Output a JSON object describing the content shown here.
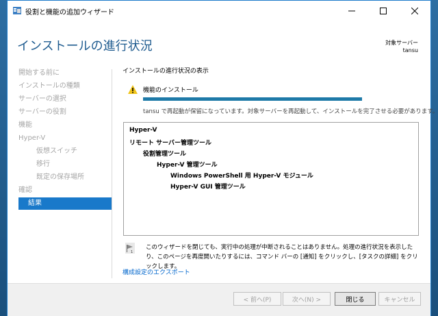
{
  "window": {
    "title": "役割と機能の追加ウィザード",
    "min_icon": "minimize-icon",
    "max_icon": "maximize-icon",
    "close_icon": "close-icon"
  },
  "header": {
    "title": "インストールの進行状況",
    "target_label": "対象サーバー",
    "target_name": "tansu"
  },
  "sidebar": {
    "items": [
      {
        "label": "開始する前に",
        "indent": false,
        "active": false
      },
      {
        "label": "インストールの種類",
        "indent": false,
        "active": false
      },
      {
        "label": "サーバーの選択",
        "indent": false,
        "active": false
      },
      {
        "label": "サーバーの役割",
        "indent": false,
        "active": false
      },
      {
        "label": "機能",
        "indent": false,
        "active": false
      },
      {
        "label": "Hyper-V",
        "indent": false,
        "active": false
      },
      {
        "label": "仮想スイッチ",
        "indent": true,
        "active": false
      },
      {
        "label": "移行",
        "indent": true,
        "active": false
      },
      {
        "label": "既定の保存場所",
        "indent": true,
        "active": false
      },
      {
        "label": "確認",
        "indent": false,
        "active": false
      },
      {
        "label": "結果",
        "indent": false,
        "active": true
      }
    ]
  },
  "content": {
    "section_title": "インストールの進行状況の表示",
    "install_label": "機能のインストール",
    "progress_fraction": 1.0,
    "restart_message": "tansu で再起動が保留になっています。対象サーバーを再起動して、インストールを完了させる必要があります。",
    "features": [
      {
        "label": "Hyper-V",
        "level": 0
      },
      {
        "label": "リモート サーバー管理ツール",
        "level": 0
      },
      {
        "label": "役割管理ツール",
        "level": 1
      },
      {
        "label": "Hyper-V 管理ツール",
        "level": 2
      },
      {
        "label": "Windows PowerShell 用 Hyper-V モジュール",
        "level": 3
      },
      {
        "label": "Hyper-V GUI 管理ツール",
        "level": 3
      }
    ],
    "info_text": "このウィザードを閉じても、実行中の処理が中断されることはありません。処理の進行状況を表示したり、このページを再度開いたりするには、コマンド バーの [通知] をクリックし、[タスクの詳細] をクリックします。",
    "export_link": "構成設定のエクスポート"
  },
  "footer": {
    "prev_label": "< 前へ(P)",
    "next_label": "次へ(N) >",
    "close_label": "閉じる",
    "cancel_label": "キャンセル"
  },
  "colors": {
    "accent": "#1979ca",
    "title_blue": "#1e5b8f",
    "progress": "#1e7aa8",
    "disabled_text": "#a6a6a6",
    "warning": "#f0c419"
  }
}
